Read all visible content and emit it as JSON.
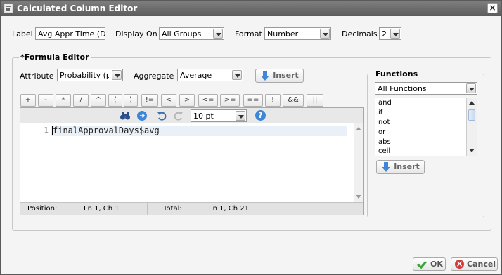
{
  "window": {
    "title": "Calculated Column Editor",
    "close_symbol": "×"
  },
  "top_row": {
    "label_caption": "Label",
    "label_value": "Avg Appr Time (Days)",
    "display_on_caption": "Display On",
    "display_on_value": "All Groups",
    "format_caption": "Format",
    "format_value": "Number",
    "decimals_caption": "Decimals",
    "decimals_value": "2"
  },
  "formula_editor": {
    "title": "*Formula Editor",
    "attribute_caption": "Attribute",
    "attribute_value": "Probability (pro",
    "aggregate_caption": "Aggregate",
    "aggregate_value": "Average",
    "insert_label": "Insert",
    "operators": [
      "+",
      "-",
      "*",
      "/",
      "^",
      "(",
      ")",
      "!=",
      "<",
      ">",
      "<=",
      ">=",
      "==",
      "!",
      "&&",
      "||"
    ],
    "toolbar": {
      "font_size": "10 pt",
      "help": "?"
    },
    "line_number": "1",
    "code": "finalApprovalDays$avg",
    "status": {
      "position_caption": "Position:",
      "position_value": "Ln 1, Ch 1",
      "total_caption": "Total:",
      "total_value": "Ln 1, Ch 21"
    }
  },
  "functions": {
    "title": "Functions",
    "filter_value": "All Functions",
    "items": [
      "and",
      "if",
      "not",
      "or",
      "abs",
      "ceil"
    ],
    "insert_label": "Insert"
  },
  "footer": {
    "ok_label": "OK",
    "cancel_label": "Cancel"
  },
  "colors": {
    "titlebar": "#6b6b6b",
    "accent_blue": "#3f86d6",
    "ok_green": "#3aa23a",
    "cancel_red": "#d23a3a"
  }
}
